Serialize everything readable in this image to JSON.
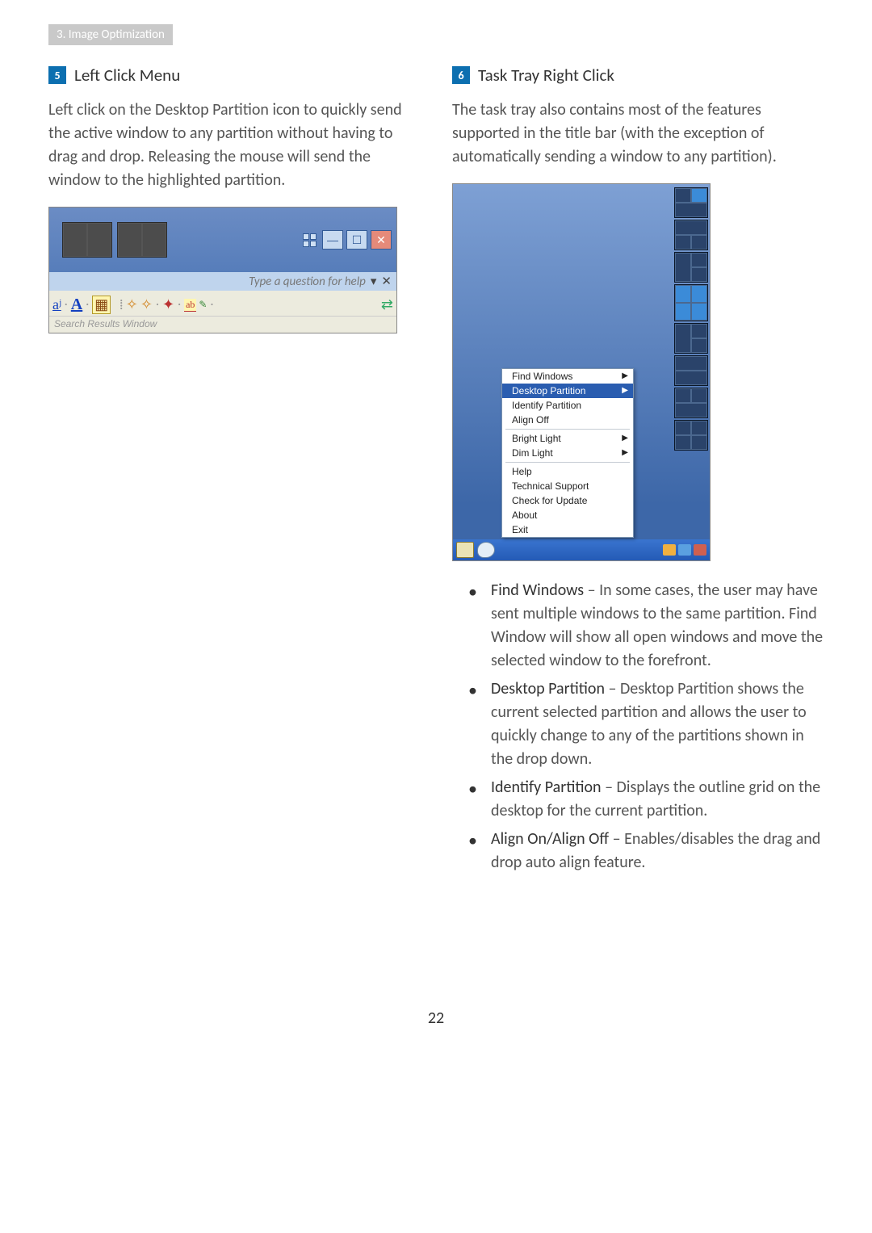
{
  "chapter_tab": "3. Image Optimization",
  "page_number": "22",
  "left": {
    "num": "5",
    "title": "Left Click Menu",
    "body": "Left click on the Desktop Partition icon to quickly send the active window to any partition without having to drag and drop. Releasing the mouse will send the window to the highlighted partition.",
    "fig": {
      "help_text": "Type a question for help",
      "bottom_text": "Search Results    Window",
      "win_min": "—",
      "win_max": "☐",
      "win_close": "✕",
      "help_dd": "▾",
      "help_close": "✕"
    }
  },
  "right": {
    "num": "6",
    "title": "Task Tray Right Click",
    "body": "The task tray also contains most of the features supported in the title bar (with the exception of automatically sending a window to any partition).",
    "ctx_menu": {
      "items": [
        "Find Windows",
        "Desktop Partition",
        "Identify Partition",
        "Align Off",
        "Bright Light",
        "Dim Light",
        "Help",
        "Technical Support",
        "Check for Update",
        "About",
        "Exit"
      ]
    },
    "features": [
      {
        "term": "Find Windows",
        "desc": " – In some cases, the user may have sent multiple windows to the same partition.  Find Window will show all open windows and move the selected window to the forefront."
      },
      {
        "term": "Desktop Partition",
        "desc": " – Desktop Partition shows the current selected partition and allows the user to quickly change to any of the partitions shown in the drop down."
      },
      {
        "term": "Identify Partition",
        "desc": " – Displays the outline grid on the desktop for the current partition."
      },
      {
        "term": "Align On/Align Off",
        "desc": " – Enables/disables the drag and drop auto align feature."
      }
    ]
  }
}
